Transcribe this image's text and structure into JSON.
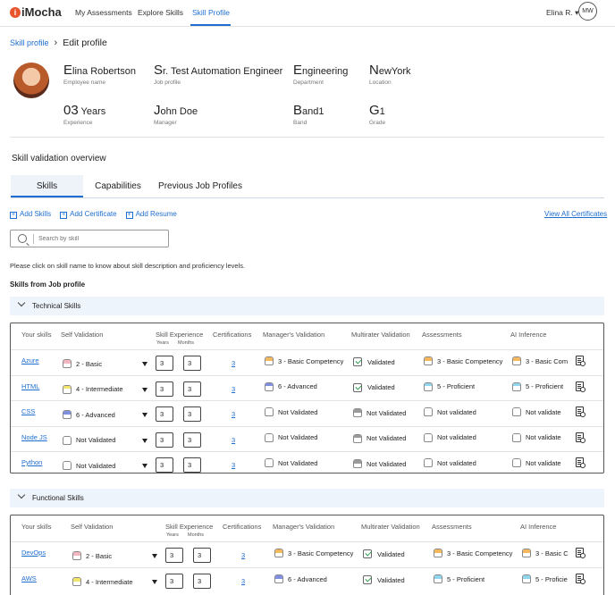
{
  "nav": {
    "logo": "iMocha",
    "links": [
      "My Assessments",
      "Explore Skills",
      "Skill Profile"
    ],
    "user": "Elina R. ▾",
    "initials": "MW"
  },
  "breadcrumb": {
    "root": "Skill profile",
    "current": "Edit profile"
  },
  "profile": {
    "name_cap": "E",
    "name_rest": "lina Robertson",
    "name_label": "Employee name",
    "job_cap": "S",
    "job_rest": "r. Test Automation Engineer",
    "job_label": "Job profile",
    "dept_cap": "E",
    "dept_rest": "ngineering",
    "dept_label": "Department",
    "loc_cap": "N",
    "loc_rest": "ewYork",
    "loc_label": "Location",
    "exp_cap": "03",
    "exp_rest": " Years",
    "exp_label": "Experience",
    "mgr_cap": "J",
    "mgr_rest": "ohn Doe",
    "mgr_label": "Manager",
    "band_cap": "B",
    "band_rest": "and1",
    "band_label": "Band",
    "grade_cap": "G",
    "grade_rest": "1",
    "grade_label": "Grade"
  },
  "overview_title": "Skill validation overview",
  "tabs": [
    "Skills",
    "Capabilities",
    "Previous Job Profiles"
  ],
  "actions": [
    "Add Skills",
    "Add Certificate",
    "Add Resume"
  ],
  "view_all": "View All Certificates",
  "search": {
    "placeholder": "Search by skill"
  },
  "hint": "Please click on skill name to know about skill description and proficiency levels.",
  "subtitle": "Skills from Job profile",
  "columns": {
    "your_skills": "Your skills",
    "self_validation": "Self Validation",
    "skill_experience": "Skill Experience",
    "years": "Years",
    "months": "Months",
    "certifications": "Certifications",
    "manager_validation": "Manager's Validation",
    "multirater": "Multirater Validation",
    "assessments": "Assessments",
    "ai_inference": "AI Inference"
  },
  "technical": {
    "title": "Technical Skills",
    "rows": [
      {
        "skill": "Azure",
        "self": "2 - Basic",
        "self_color": "#f2b6bf",
        "years": "3",
        "months": "3",
        "cert": "3",
        "mgr": "3 - Basic Competency",
        "mgr_color": "#f5b85c",
        "multi": "Validated",
        "multi_ok": true,
        "assess": "3 - Basic Competency",
        "assess_color": "#f5b85c",
        "ai": "3 - Basic Com",
        "ai_color": "#f5b85c"
      },
      {
        "skill": "HTML",
        "self": "4 - Intermediate",
        "self_color": "#f3e46a",
        "years": "3",
        "months": "3",
        "cert": "3",
        "mgr": "6 - Advanced",
        "mgr_color": "#7f8fe0",
        "multi": "Validated",
        "multi_ok": true,
        "assess": "5 - Proficient",
        "assess_color": "#8fd5ec",
        "ai": "5 - Proficient",
        "ai_color": "#8fd5ec"
      },
      {
        "skill": "CSS",
        "self": "6 - Advanced",
        "self_color": "#7f8fe0",
        "years": "3",
        "months": "3",
        "cert": "3",
        "mgr": "Not Validated",
        "mgr_color": "#ffffff",
        "multi": "Not Validated",
        "multi_ok": false,
        "assess": "Not  validated",
        "assess_color": "#ffffff",
        "ai": "Not validate",
        "ai_color": "#ffffff"
      },
      {
        "skill": "Node JS",
        "self": "Not Validated",
        "self_color": "#ffffff",
        "years": "3",
        "months": "3",
        "cert": "3",
        "mgr": "Not Validated",
        "mgr_color": "#ffffff",
        "multi": "Not Validated",
        "multi_ok": false,
        "assess": "Not  validated",
        "assess_color": "#ffffff",
        "ai": "Not validate",
        "ai_color": "#ffffff"
      },
      {
        "skill": "Python",
        "self": "Not Validated",
        "self_color": "#ffffff",
        "years": "3",
        "months": "3",
        "cert": "3",
        "mgr": "Not Validated",
        "mgr_color": "#ffffff",
        "multi": "Not Validated",
        "multi_ok": false,
        "assess": "Not  validated",
        "assess_color": "#ffffff",
        "ai": "Not validate",
        "ai_color": "#ffffff"
      }
    ]
  },
  "functional": {
    "title": "Functional Skills",
    "rows": [
      {
        "skill": "DevOps",
        "self": "2 - Basic",
        "self_color": "#f2b6bf",
        "years": "3",
        "months": "3",
        "cert": "3",
        "mgr": "3 - Basic Competency",
        "mgr_color": "#f5b85c",
        "multi": "Validated",
        "multi_ok": true,
        "assess": "3 - Basic Competency",
        "assess_color": "#f5b85c",
        "ai": "3 - Basic C",
        "ai_color": "#f5b85c"
      },
      {
        "skill": "AWS",
        "self": "4 - Intermediate",
        "self_color": "#f3e46a",
        "years": "3",
        "months": "3",
        "cert": "3",
        "mgr": "6 - Advanced",
        "mgr_color": "#7f8fe0",
        "multi": "Validated",
        "multi_ok": true,
        "assess": "5 - Proficient",
        "assess_color": "#8fd5ec",
        "ai": "5 - Proficie",
        "ai_color": "#8fd5ec"
      }
    ]
  }
}
